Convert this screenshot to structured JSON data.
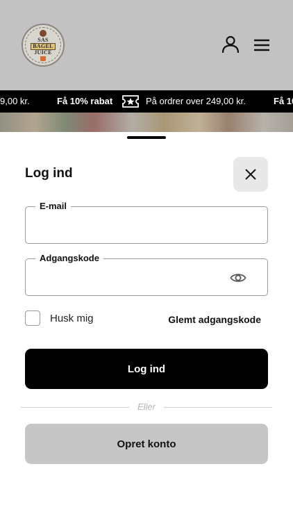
{
  "brand": {
    "logo_line1": "SAS",
    "logo_line2": "BAGEL",
    "logo_line3": "JUICE"
  },
  "header": {
    "user_icon": "user-icon",
    "menu_icon": "hamburger-menu-icon"
  },
  "ticker": {
    "items": [
      "9,00 kr.",
      "Få 10% rabat",
      "På ordrer over 249,00 kr.",
      "Få 10"
    ],
    "icon": "ticket-star-icon"
  },
  "login": {
    "title": "Log ind",
    "close_icon": "close-icon",
    "email_label": "E-mail",
    "email_value": "",
    "password_label": "Adgangskode",
    "password_value": "",
    "eye_icon": "eye-icon",
    "remember_label": "Husk mig",
    "forgot_label": "Glemt adgangskode",
    "submit_label": "Log ind",
    "or_label": "Eller",
    "create_label": "Opret konto"
  }
}
